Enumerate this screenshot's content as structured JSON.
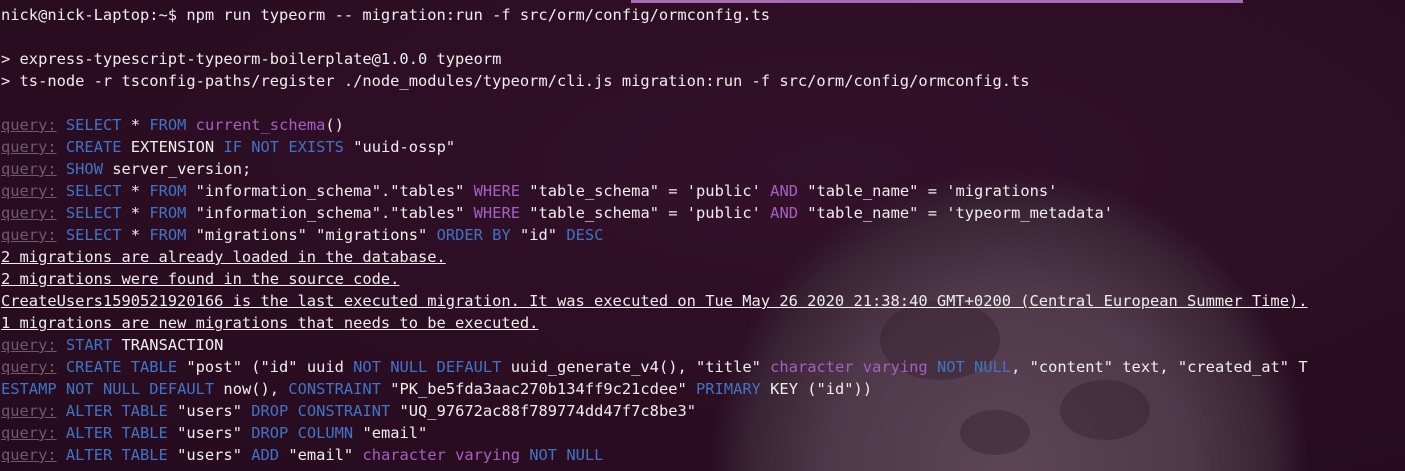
{
  "terminal": {
    "prompt": "nick@nick-Laptop:~$ npm run typeorm -- migration:run -f src/orm/config/ormconfig.ts",
    "npm_lines": [
      "> express-typescript-typeorm-boilerplate@1.0.0 typeorm",
      "> ts-node -r tsconfig-paths/register ./node_modules/typeorm/cli.js migration:run -f src/orm/config/ormconfig.ts"
    ],
    "query_label": "query:",
    "q1": {
      "a": "SELECT",
      "b": " * ",
      "c": "FROM",
      "d": " ",
      "e": "current_schema",
      "f": "()"
    },
    "q2": {
      "a": "CREATE",
      "b": " EXTENSION ",
      "c": "IF",
      "d": " ",
      "e": "NOT EXISTS",
      "f": " \"uuid-ossp\""
    },
    "q3": {
      "a": "SHOW",
      "b": " server_version;"
    },
    "q4": {
      "a": "SELECT",
      "b": " * ",
      "c": "FROM",
      "d": " \"information_schema\".\"tables\" ",
      "e": "WHERE",
      "f": " \"table_schema\" = 'public' ",
      "g": "AND",
      "h": " \"table_name\" = 'migrations'"
    },
    "q5": {
      "a": "SELECT",
      "b": " * ",
      "c": "FROM",
      "d": " \"information_schema\".\"tables\" ",
      "e": "WHERE",
      "f": " \"table_schema\" = 'public' ",
      "g": "AND",
      "h": " \"table_name\" = 'typeorm_metadata'"
    },
    "q6": {
      "a": "SELECT",
      "b": " * ",
      "c": "FROM",
      "d": " \"migrations\" \"migrations\" ",
      "e": "ORDER BY",
      "f": " \"id\" ",
      "g": "DESC"
    },
    "info1": "2 migrations are already loaded in the database.",
    "info2": "2 migrations were found in the source code.",
    "info3": "CreateUsers1590521920166 is the last executed migration. It was executed on Tue May 26 2020 21:38:40 GMT+0200 (Central European Summer Time).",
    "info4": "1 migrations are new migrations that needs to be executed.",
    "q7": {
      "a": "START",
      "b": " TRANSACTION"
    },
    "q8": {
      "a": "CREATE TABLE",
      "b": " \"post\" (\"id\" uuid ",
      "c": "NOT NULL DEFAULT",
      "d": " uuid_generate_v4(), \"title\" ",
      "e": "character varying",
      "f": " ",
      "g": "NOT NULL",
      "h": ", \"content\" text, \"created_at\" T"
    },
    "q8b": {
      "a": "ESTAMP",
      "b": " ",
      "c": "NOT NULL DEFAULT",
      "d": " now(), ",
      "e": "CONSTRAINT",
      "f": " \"PK_be5fda3aac270b134ff9c21cdee\" ",
      "g": "PRIMARY",
      "h": " KEY (\"id\"))"
    },
    "q9": {
      "a": "ALTER TABLE",
      "b": " \"users\" ",
      "c": "DROP CONSTRAINT",
      "d": " \"UQ_97672ac88f789774dd47f7c8be3\""
    },
    "q10": {
      "a": "ALTER TABLE",
      "b": " \"users\" ",
      "c": "DROP COLUMN",
      "d": " \"email\""
    },
    "q11": {
      "a": "ALTER TABLE",
      "b": " \"users\" ",
      "c": "ADD",
      "d": " \"email\" ",
      "e": "character varying",
      "f": " ",
      "g": "NOT NULL"
    }
  }
}
